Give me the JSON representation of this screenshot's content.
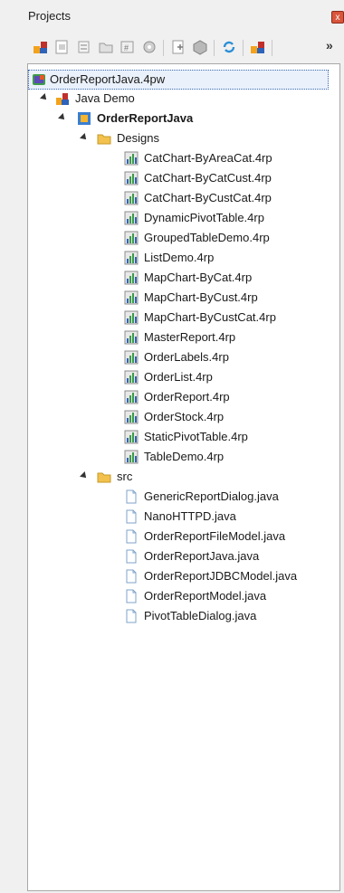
{
  "panel": {
    "title": "Projects",
    "close_label": "x"
  },
  "toolbar": {
    "buttons": [
      "new-project-icon",
      "copy-icon",
      "paste-icon",
      "open-folder-icon",
      "build-icon",
      "settings-icon",
      "add-file-icon",
      "package-icon",
      "refresh-icon",
      "component-icon"
    ],
    "more_label": "»"
  },
  "tree": {
    "root": "OrderReportJava.4pw",
    "app": "Java Demo",
    "project": "OrderReportJava",
    "designs_folder": "Designs",
    "designs": [
      "CatChart-ByAreaCat.4rp",
      "CatChart-ByCatCust.4rp",
      "CatChart-ByCustCat.4rp",
      "DynamicPivotTable.4rp",
      "GroupedTableDemo.4rp",
      "ListDemo.4rp",
      "MapChart-ByCat.4rp",
      "MapChart-ByCust.4rp",
      "MapChart-ByCustCat.4rp",
      "MasterReport.4rp",
      "OrderLabels.4rp",
      "OrderList.4rp",
      "OrderReport.4rp",
      "OrderStock.4rp",
      "StaticPivotTable.4rp",
      "TableDemo.4rp"
    ],
    "src_folder": "src",
    "sources": [
      "GenericReportDialog.java",
      "NanoHTTPD.java",
      "OrderReportFileModel.java",
      "OrderReportJava.java",
      "OrderReportJDBCModel.java",
      "OrderReportModel.java",
      "PivotTableDialog.java"
    ]
  }
}
